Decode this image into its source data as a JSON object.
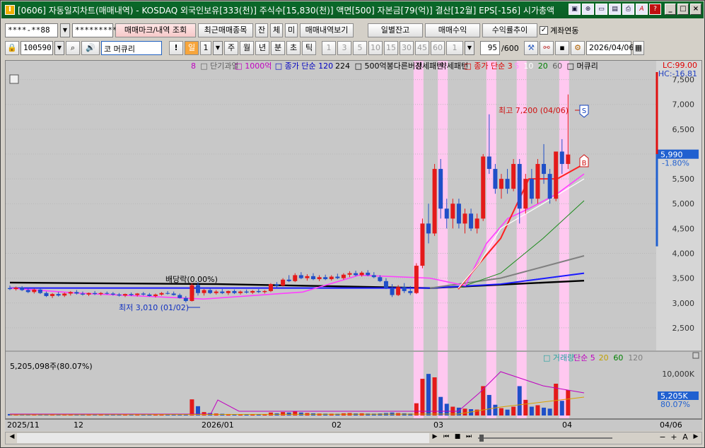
{
  "title": "[0606] 자동일지차트(매매내역) - KOSDAQ 외국인보유[333(천)] 주식수[15,830(천)] 액면[500] 자본금[79(억)] 결산[12월] EPS[-156] 시가총액",
  "app_icon": "I",
  "toolbar": {
    "account": "****-**88",
    "password": "*********",
    "trade_mark_btn": "매매마크/내역 조회",
    "recent_items_btn": "최근매매종목",
    "balance_btn": "잔",
    "filled_btn": "체",
    "unfilled_btn": "미",
    "history_view_btn": "매매내역보기",
    "daily_balance_btn": "일별잔고",
    "trade_profit_btn": "매매수익",
    "return_trend_btn": "수익률추이",
    "account_link_label": "계좌연동",
    "account_link_checked": true
  },
  "toolbar2": {
    "code": "100590",
    "market": "코",
    "stock_name": "머큐리",
    "excl": "!",
    "period_selected": "일",
    "period_num": "1",
    "periods": [
      "주",
      "월",
      "년",
      "분",
      "초",
      "틱"
    ],
    "minutes": [
      "1",
      "3",
      "5",
      "10",
      "15",
      "30",
      "45",
      "60"
    ],
    "minute_sel": "1",
    "count": "95",
    "count_total": "/600",
    "date": "2026/04/06"
  },
  "legend_top": [
    {
      "text": "8",
      "color": "#c000c0"
    },
    {
      "text": "□ 단기과열",
      "color": "#606060"
    },
    {
      "text": "□ 1000억",
      "color": "#c000c0"
    },
    {
      "text": "□ 종가 단순 120",
      "color": "#0000c0"
    },
    {
      "text": "224",
      "color": "#000000"
    },
    {
      "text": "□ 500억봉다른버전",
      "color": "#000000"
    },
    {
      "text": "강세패턴",
      "color": "#000000"
    },
    {
      "text": "약세패턴",
      "color": "#000000"
    },
    {
      "text": "□ 종가 단순 3",
      "color": "#e00000"
    },
    {
      "text": "5",
      "color": "#ff90ff"
    },
    {
      "text": "10",
      "color": "#ffffff"
    },
    {
      "text": "20",
      "color": "#008000"
    },
    {
      "text": "60",
      "color": "#606060"
    },
    {
      "text": "□ 머큐리",
      "color": "#000000"
    }
  ],
  "price_axis": [
    "7,500",
    "7,000",
    "6,500",
    "6,000",
    "5,500",
    "5,000",
    "4,500",
    "4,000",
    "3,500",
    "3,000",
    "2,500"
  ],
  "lc": "LC:99.00",
  "hc": "HC:-16.81",
  "current_price": "5,990",
  "change_pct": "-1.80%",
  "high_note": "최고 7,200 (04/06)",
  "low_note": "최저 3,010 (01/02)",
  "dividend_note": "배당락(0.00%)",
  "markers": {
    "sell": "S",
    "buy": "B"
  },
  "volume_legend": [
    {
      "text": "□ 거래량",
      "color": "#20a0a0"
    },
    {
      "text": "단순 5",
      "color": "#c000c0"
    },
    {
      "text": "20",
      "color": "#c0a000"
    },
    {
      "text": "60",
      "color": "#008000"
    },
    {
      "text": "120",
      "color": "#808080"
    }
  ],
  "volume_info": "5,205,098주(80.07%)",
  "volume_axis": "10,000K",
  "current_volume": "5,205K",
  "volume_pct": "80.07%",
  "x_labels": [
    "2025/11",
    "12",
    "2026/01",
    "02",
    "03",
    "04"
  ],
  "x_right": "04/06",
  "colors": {
    "up": "#e41a1a",
    "down": "#1f4fc8",
    "bg": "#c8c8c8",
    "highlight": "#ffc8f0",
    "title_bg": "#0b5d24"
  },
  "chart_data": {
    "type": "candlestick",
    "ylim": [
      2100,
      7850
    ],
    "vol_ylim": [
      0,
      13000
    ],
    "candles": [
      {
        "o": 3300,
        "h": 3350,
        "l": 3260,
        "c": 3280,
        "v": 300
      },
      {
        "o": 3280,
        "h": 3330,
        "l": 3250,
        "c": 3310,
        "v": 250
      },
      {
        "o": 3310,
        "h": 3340,
        "l": 3240,
        "c": 3260,
        "v": 240
      },
      {
        "o": 3260,
        "h": 3300,
        "l": 3200,
        "c": 3220,
        "v": 260
      },
      {
        "o": 3220,
        "h": 3290,
        "l": 3190,
        "c": 3270,
        "v": 230
      },
      {
        "o": 3270,
        "h": 3300,
        "l": 3180,
        "c": 3200,
        "v": 220
      },
      {
        "o": 3200,
        "h": 3230,
        "l": 3120,
        "c": 3140,
        "v": 280
      },
      {
        "o": 3140,
        "h": 3200,
        "l": 3100,
        "c": 3180,
        "v": 230
      },
      {
        "o": 3180,
        "h": 3220,
        "l": 3130,
        "c": 3150,
        "v": 210
      },
      {
        "o": 3150,
        "h": 3210,
        "l": 3120,
        "c": 3190,
        "v": 200
      },
      {
        "o": 3190,
        "h": 3240,
        "l": 3150,
        "c": 3220,
        "v": 220
      },
      {
        "o": 3220,
        "h": 3260,
        "l": 3170,
        "c": 3190,
        "v": 200
      },
      {
        "o": 3190,
        "h": 3230,
        "l": 3150,
        "c": 3170,
        "v": 190
      },
      {
        "o": 3170,
        "h": 3210,
        "l": 3140,
        "c": 3200,
        "v": 180
      },
      {
        "o": 3200,
        "h": 3240,
        "l": 3160,
        "c": 3180,
        "v": 190
      },
      {
        "o": 3180,
        "h": 3220,
        "l": 3150,
        "c": 3200,
        "v": 170
      },
      {
        "o": 3200,
        "h": 3230,
        "l": 3170,
        "c": 3190,
        "v": 160
      },
      {
        "o": 3190,
        "h": 3220,
        "l": 3150,
        "c": 3170,
        "v": 160
      },
      {
        "o": 3170,
        "h": 3200,
        "l": 3130,
        "c": 3150,
        "v": 170
      },
      {
        "o": 3150,
        "h": 3190,
        "l": 3120,
        "c": 3180,
        "v": 150
      },
      {
        "o": 3180,
        "h": 3210,
        "l": 3140,
        "c": 3160,
        "v": 150
      },
      {
        "o": 3160,
        "h": 3200,
        "l": 3130,
        "c": 3190,
        "v": 140
      },
      {
        "o": 3190,
        "h": 3220,
        "l": 3150,
        "c": 3170,
        "v": 140
      },
      {
        "o": 3170,
        "h": 3200,
        "l": 3130,
        "c": 3140,
        "v": 150
      },
      {
        "o": 3140,
        "h": 3190,
        "l": 3110,
        "c": 3170,
        "v": 160
      },
      {
        "o": 3170,
        "h": 3220,
        "l": 3150,
        "c": 3200,
        "v": 160
      },
      {
        "o": 3200,
        "h": 3240,
        "l": 3170,
        "c": 3190,
        "v": 150
      },
      {
        "o": 3190,
        "h": 3230,
        "l": 3150,
        "c": 3160,
        "v": 160
      },
      {
        "o": 3160,
        "h": 3190,
        "l": 3090,
        "c": 3100,
        "v": 200
      },
      {
        "o": 3100,
        "h": 3140,
        "l": 3010,
        "c": 3040,
        "v": 220
      },
      {
        "o": 3040,
        "h": 3400,
        "l": 3030,
        "c": 3360,
        "v": 3300
      },
      {
        "o": 3360,
        "h": 3420,
        "l": 3150,
        "c": 3200,
        "v": 1900
      },
      {
        "o": 3200,
        "h": 3280,
        "l": 3150,
        "c": 3260,
        "v": 700
      },
      {
        "o": 3260,
        "h": 3300,
        "l": 3180,
        "c": 3200,
        "v": 500
      },
      {
        "o": 3200,
        "h": 3260,
        "l": 3170,
        "c": 3230,
        "v": 400
      },
      {
        "o": 3230,
        "h": 3280,
        "l": 3180,
        "c": 3200,
        "v": 350
      },
      {
        "o": 3200,
        "h": 3250,
        "l": 3160,
        "c": 3240,
        "v": 300
      },
      {
        "o": 3240,
        "h": 3270,
        "l": 3180,
        "c": 3200,
        "v": 280
      },
      {
        "o": 3200,
        "h": 3250,
        "l": 3170,
        "c": 3230,
        "v": 260
      },
      {
        "o": 3230,
        "h": 3270,
        "l": 3190,
        "c": 3210,
        "v": 250
      },
      {
        "o": 3210,
        "h": 3260,
        "l": 3180,
        "c": 3240,
        "v": 240
      },
      {
        "o": 3240,
        "h": 3280,
        "l": 3200,
        "c": 3220,
        "v": 250
      },
      {
        "o": 3220,
        "h": 3260,
        "l": 3190,
        "c": 3240,
        "v": 230
      },
      {
        "o": 3240,
        "h": 3400,
        "l": 3220,
        "c": 3380,
        "v": 600
      },
      {
        "o": 3380,
        "h": 3420,
        "l": 3300,
        "c": 3350,
        "v": 450
      },
      {
        "o": 3350,
        "h": 3500,
        "l": 3330,
        "c": 3470,
        "v": 700
      },
      {
        "o": 3470,
        "h": 3560,
        "l": 3420,
        "c": 3440,
        "v": 600
      },
      {
        "o": 3440,
        "h": 3600,
        "l": 3420,
        "c": 3560,
        "v": 800
      },
      {
        "o": 3560,
        "h": 3620,
        "l": 3480,
        "c": 3500,
        "v": 600
      },
      {
        "o": 3500,
        "h": 3580,
        "l": 3450,
        "c": 3540,
        "v": 500
      },
      {
        "o": 3540,
        "h": 3600,
        "l": 3460,
        "c": 3480,
        "v": 450
      },
      {
        "o": 3480,
        "h": 3560,
        "l": 3440,
        "c": 3520,
        "v": 400
      },
      {
        "o": 3520,
        "h": 3570,
        "l": 3460,
        "c": 3480,
        "v": 380
      },
      {
        "o": 3480,
        "h": 3560,
        "l": 3450,
        "c": 3530,
        "v": 370
      },
      {
        "o": 3530,
        "h": 3590,
        "l": 3480,
        "c": 3500,
        "v": 360
      },
      {
        "o": 3500,
        "h": 3600,
        "l": 3470,
        "c": 3570,
        "v": 450
      },
      {
        "o": 3570,
        "h": 3640,
        "l": 3520,
        "c": 3600,
        "v": 500
      },
      {
        "o": 3600,
        "h": 3650,
        "l": 3540,
        "c": 3560,
        "v": 420
      },
      {
        "o": 3560,
        "h": 3640,
        "l": 3530,
        "c": 3610,
        "v": 450
      },
      {
        "o": 3610,
        "h": 3660,
        "l": 3540,
        "c": 3560,
        "v": 400
      },
      {
        "o": 3560,
        "h": 3620,
        "l": 3500,
        "c": 3520,
        "v": 380
      },
      {
        "o": 3520,
        "h": 3560,
        "l": 3420,
        "c": 3440,
        "v": 420
      },
      {
        "o": 3440,
        "h": 3500,
        "l": 3280,
        "c": 3300,
        "v": 500
      },
      {
        "o": 3300,
        "h": 3380,
        "l": 3120,
        "c": 3160,
        "v": 600
      },
      {
        "o": 3160,
        "h": 3360,
        "l": 3140,
        "c": 3320,
        "v": 500
      },
      {
        "o": 3320,
        "h": 3400,
        "l": 3200,
        "c": 3240,
        "v": 450
      },
      {
        "o": 3240,
        "h": 3340,
        "l": 3160,
        "c": 3200,
        "v": 400
      },
      {
        "o": 3200,
        "h": 3800,
        "l": 3180,
        "c": 3750,
        "v": 2500
      },
      {
        "o": 3750,
        "h": 4700,
        "l": 3700,
        "c": 4600,
        "v": 7500
      },
      {
        "o": 4600,
        "h": 5000,
        "l": 4200,
        "c": 4400,
        "v": 8500
      },
      {
        "o": 4400,
        "h": 5800,
        "l": 4350,
        "c": 5700,
        "v": 7800
      },
      {
        "o": 5700,
        "h": 5900,
        "l": 4700,
        "c": 4900,
        "v": 3800
      },
      {
        "o": 4900,
        "h": 5100,
        "l": 4500,
        "c": 4700,
        "v": 2400
      },
      {
        "o": 4700,
        "h": 5100,
        "l": 4500,
        "c": 5000,
        "v": 1800
      },
      {
        "o": 5000,
        "h": 5100,
        "l": 4500,
        "c": 4600,
        "v": 1600
      },
      {
        "o": 4600,
        "h": 4900,
        "l": 4400,
        "c": 4800,
        "v": 1400
      },
      {
        "o": 4800,
        "h": 4900,
        "l": 4450,
        "c": 4500,
        "v": 1300
      },
      {
        "o": 4500,
        "h": 4800,
        "l": 4400,
        "c": 4700,
        "v": 1200
      },
      {
        "o": 4700,
        "h": 6000,
        "l": 4650,
        "c": 5950,
        "v": 6000
      },
      {
        "o": 5950,
        "h": 6800,
        "l": 5600,
        "c": 5700,
        "v": 4200
      },
      {
        "o": 5700,
        "h": 5800,
        "l": 5200,
        "c": 5300,
        "v": 2200
      },
      {
        "o": 5300,
        "h": 5600,
        "l": 5100,
        "c": 5500,
        "v": 1500
      },
      {
        "o": 5500,
        "h": 5700,
        "l": 5200,
        "c": 5300,
        "v": 1200
      },
      {
        "o": 5300,
        "h": 5900,
        "l": 5250,
        "c": 5800,
        "v": 1800
      },
      {
        "o": 5800,
        "h": 5900,
        "l": 4600,
        "c": 4900,
        "v": 6000
      },
      {
        "o": 4900,
        "h": 5600,
        "l": 4800,
        "c": 5500,
        "v": 3200
      },
      {
        "o": 5500,
        "h": 5700,
        "l": 5000,
        "c": 5100,
        "v": 1800
      },
      {
        "o": 5100,
        "h": 5900,
        "l": 5000,
        "c": 5800,
        "v": 2100
      },
      {
        "o": 5800,
        "h": 6200,
        "l": 5400,
        "c": 5600,
        "v": 1600
      },
      {
        "o": 5600,
        "h": 5700,
        "l": 5000,
        "c": 5100,
        "v": 1400
      },
      {
        "o": 5100,
        "h": 6000,
        "l": 5050,
        "c": 6050,
        "v": 6500
      },
      {
        "o": 6050,
        "h": 6300,
        "l": 5600,
        "c": 5800,
        "v": 3000
      },
      {
        "o": 5800,
        "h": 7200,
        "l": 5700,
        "c": 5990,
        "v": 5205
      }
    ],
    "highlights": [
      67,
      71,
      79,
      84,
      91
    ],
    "ma_black": [
      3420,
      3390,
      3400
    ],
    "ma_blue": [
      3310,
      3380,
      3560
    ],
    "ma_gray": [
      3300,
      3340,
      3550,
      3900
    ],
    "ma_green": [
      3290,
      3310,
      3700,
      4600,
      5050
    ]
  }
}
